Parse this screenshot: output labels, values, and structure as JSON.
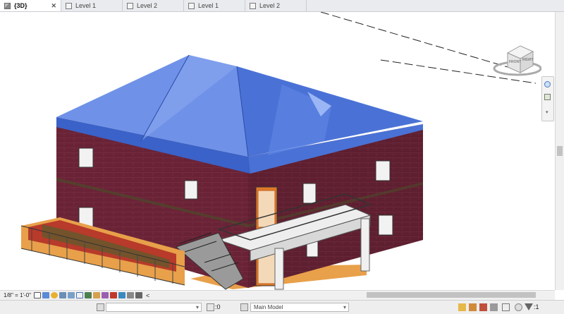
{
  "tabs": [
    {
      "label": "{3D}",
      "icon": "3d-cube-icon",
      "active": true,
      "close": "✕"
    },
    {
      "label": "Level 1",
      "icon": "floor-plan-icon",
      "active": false
    },
    {
      "label": "Level 2",
      "icon": "floor-plan-icon",
      "active": false
    },
    {
      "label": "Level 1",
      "icon": "floor-plan-icon",
      "active": false
    },
    {
      "label": "Level 2",
      "icon": "floor-plan-icon",
      "active": false
    }
  ],
  "viewcube": {
    "front": "FRONT",
    "right": "RIGHT"
  },
  "view_control": {
    "scale": "1/8\" = 1'-0\"",
    "collapse": "<"
  },
  "statusbar": {
    "workset_value": "",
    "selection_count": ":0",
    "design_option": "Main Model",
    "filter_count": ":1"
  },
  "colors": {
    "roof": "#4a72d6",
    "wall": "#6a2336",
    "window_frame": "#e8e8e8",
    "door": "#e07a2a",
    "deck": "#e8a04a",
    "hedge": "#b83a2a"
  }
}
